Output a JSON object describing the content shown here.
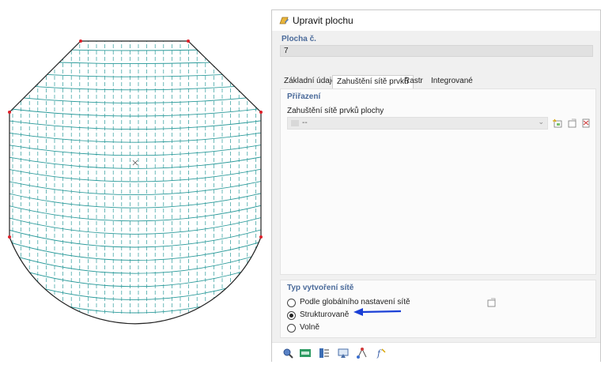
{
  "dialog": {
    "title": "Upravit plochu",
    "surface_number_label": "Plocha č.",
    "surface_number_value": "7",
    "tabs": [
      {
        "label": "Základní údaje",
        "active": false
      },
      {
        "label": "Zahuštění sítě prvků",
        "active": true
      },
      {
        "label": "Rastr",
        "active": false
      },
      {
        "label": "Integrované",
        "active": false
      }
    ],
    "assignment": {
      "group_label": "Přiřazení",
      "field_label": "Zahuštění sítě prvků plochy",
      "selected_value": "--"
    },
    "mesh_type": {
      "group_label": "Typ vytvoření sítě",
      "options": [
        {
          "label": "Podle globálního nastavení sítě",
          "selected": false
        },
        {
          "label": "Strukturovaně",
          "selected": true
        },
        {
          "label": "Volně",
          "selected": false
        }
      ]
    },
    "footer_icons": [
      "search-zoom-icon",
      "units-icon",
      "table-icon",
      "view-icon",
      "nodes-icon",
      "function-icon"
    ]
  },
  "colors": {
    "mesh": "#2a9a9a",
    "boundary": "#222222",
    "corner_nodes": "#e0202a",
    "annotation_arrow": "#1a3fd6",
    "group_label": "#4a6a9a"
  }
}
